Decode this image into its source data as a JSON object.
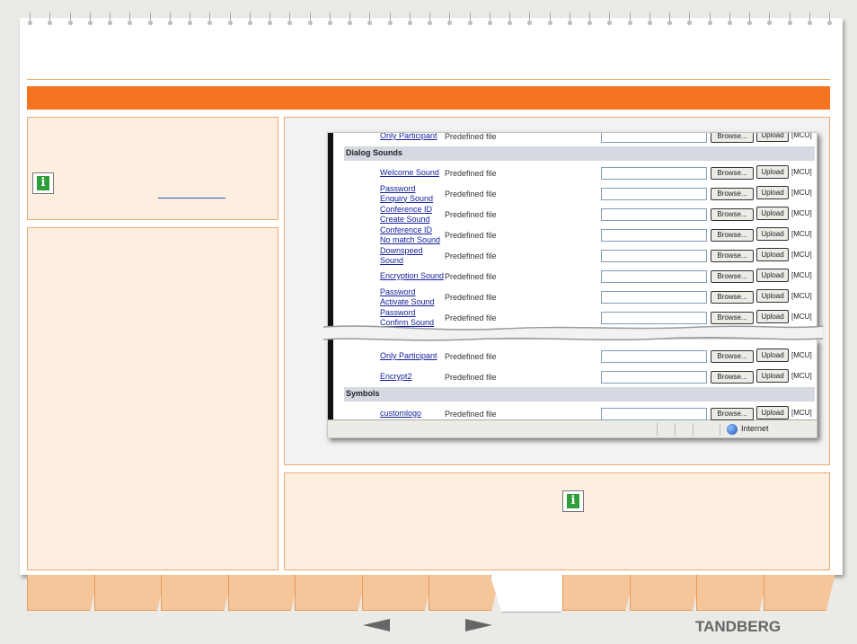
{
  "brand": {
    "logo_text": "TANDBERG"
  },
  "screenshot": {
    "top_rows": [
      {
        "type": "row",
        "name": "Only Participant",
        "file_type": "Predefined file",
        "browse": "Browse...",
        "upload": "Upload",
        "badge": "[MCU]"
      },
      {
        "type": "section",
        "title": "Dialog Sounds"
      },
      {
        "type": "row",
        "name": "Welcome Sound",
        "file_type": "Predefined file",
        "browse": "Browse...",
        "upload": "Upload",
        "badge": "[MCU]"
      },
      {
        "type": "row",
        "name": "Password Enquiry Sound",
        "file_type": "Predefined file",
        "browse": "Browse...",
        "upload": "Upload",
        "badge": "[MCU]"
      },
      {
        "type": "row",
        "name": "Conference ID Create Sound",
        "file_type": "Predefined file",
        "browse": "Browse...",
        "upload": "Upload",
        "badge": "[MCU]"
      },
      {
        "type": "row",
        "name": "Conference ID No match Sound",
        "file_type": "Predefined file",
        "browse": "Browse...",
        "upload": "Upload",
        "badge": "[MCU]"
      },
      {
        "type": "row",
        "name": "Downspeed Sound",
        "file_type": "Predefined file",
        "browse": "Browse...",
        "upload": "Upload",
        "badge": "[MCU]"
      },
      {
        "type": "row",
        "name": "Encryption Sound",
        "file_type": "Predefined file",
        "browse": "Browse...",
        "upload": "Upload",
        "badge": "[MCU]"
      },
      {
        "type": "row",
        "name": "Password Activate Sound",
        "file_type": "Predefined file",
        "browse": "Browse...",
        "upload": "Upload",
        "badge": "[MCU]"
      },
      {
        "type": "row",
        "name": "Password Confirm Sound",
        "file_type": "Predefined file",
        "browse": "Browse...",
        "upload": "Upload",
        "badge": "[MCU]"
      }
    ],
    "bottom_rows": [
      {
        "type": "row",
        "name": "Only Participant",
        "file_type": "Predefined file",
        "browse": "Browse...",
        "upload": "Upload",
        "badge": "[MCU]"
      },
      {
        "type": "row",
        "name": "Encrypt2",
        "file_type": "Predefined file",
        "browse": "Browse...",
        "upload": "Upload",
        "badge": "[MCU]"
      },
      {
        "type": "section",
        "title": "Symbols"
      },
      {
        "type": "row",
        "name": "customlogo",
        "file_type": "Predefined file",
        "browse": "Browse...",
        "upload": "Upload",
        "badge": "[MCU]"
      }
    ],
    "status_bar": {
      "zone": "Internet",
      "zone_icon": "globe-icon"
    }
  },
  "icons": {
    "info": "info-icon",
    "prev": "arrow-left-icon",
    "next": "arrow-right-icon"
  },
  "colors": {
    "accent": "#f47421",
    "panel_bg": "#fcefe0",
    "link": "#15219a"
  },
  "tabs": {
    "count": 12,
    "active_index": 7
  }
}
